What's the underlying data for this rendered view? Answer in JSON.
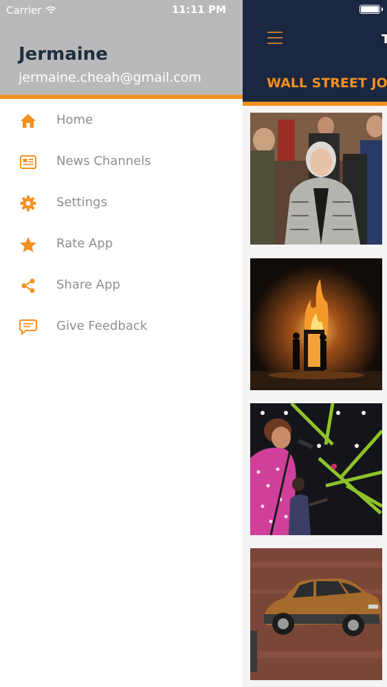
{
  "status_bar": {
    "carrier": "Carrier",
    "time": "11:11 PM"
  },
  "drawer": {
    "user_name": "Jermaine",
    "user_email": "jermaine.cheah@gmail.com",
    "menu": [
      {
        "label": "Home",
        "icon": "home-icon"
      },
      {
        "label": "News Channels",
        "icon": "newspaper-icon"
      },
      {
        "label": "Settings",
        "icon": "gear-icon"
      },
      {
        "label": "Rate App",
        "icon": "star-icon"
      },
      {
        "label": "Share App",
        "icon": "share-icon"
      },
      {
        "label": "Give Feedback",
        "icon": "chat-icon"
      }
    ]
  },
  "main": {
    "nav_title_fragment": "T",
    "channel_title": "WALL STREET JOU",
    "articles": [
      {
        "image": "woman-in-crowd-photo"
      },
      {
        "image": "fire-stage-photo"
      },
      {
        "image": "singer-concert-photo"
      },
      {
        "image": "suv-display-photo"
      }
    ]
  },
  "colors": {
    "accent": "#f3901f",
    "navbar": "#1b2740",
    "drawer_header": "#b9b9bb",
    "menu_text": "#8e8e8e"
  }
}
